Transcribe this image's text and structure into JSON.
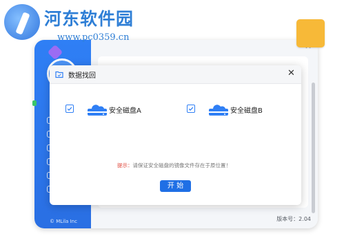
{
  "watermark": {
    "title": "河东软件园",
    "url": "www.pc0359.cn"
  },
  "app": {
    "copyright": "© MLila Inc",
    "version": "版本号：2.04"
  },
  "dialog": {
    "title": "数据找回",
    "disks": [
      {
        "label": "安全磁盘A",
        "checked": true
      },
      {
        "label": "安全磁盘B",
        "checked": true
      }
    ],
    "hint_label": "提示：",
    "hint_text": "请保证安全磁盘的镜像文件存在于原位置！",
    "start_button": "开 始"
  },
  "colors": {
    "accent": "#1f6fe5",
    "hint_label": "#e04a3f",
    "sidebar": "#2f7ff5"
  }
}
